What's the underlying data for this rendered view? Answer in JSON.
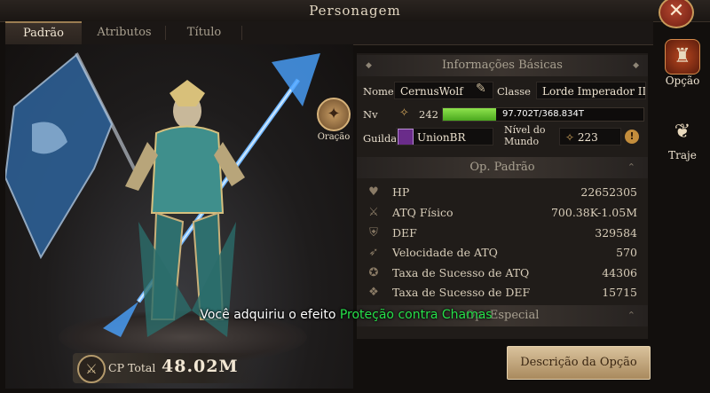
{
  "window": {
    "title": "Personagem",
    "close_glyph": "✕"
  },
  "tabs": [
    {
      "label": "Padrão",
      "active": true
    },
    {
      "label": "Atributos",
      "active": false
    },
    {
      "label": "Título",
      "active": false
    }
  ],
  "scene": {
    "oracao_label": "Oração",
    "oracao_icon": "prayer-icon"
  },
  "basic_info": {
    "header": "Informações Básicas",
    "nome_label": "Nome",
    "nome_value": "CernusWolf",
    "classe_label": "Classe",
    "classe_value": "Lorde Imperador III (INT)",
    "nv_label": "Nv",
    "nv_value": "242",
    "exp_text": "97.702T/368.834T",
    "exp_fraction": 0.265,
    "guilda_label": "Guilda",
    "guilda_value": "UnionBR",
    "nivel_mundo_label_1": "Nível do",
    "nivel_mundo_label_2": "Mundo",
    "nivel_mundo_value": "223",
    "info_glyph": "!"
  },
  "op_padrao": {
    "header": "Op. Padrão",
    "stats": [
      {
        "name": "HP",
        "value": "22652305",
        "icon": "hp-icon"
      },
      {
        "name": "ATQ Físico",
        "value": "700.38K-1.05M",
        "icon": "attack-icon"
      },
      {
        "name": "DEF",
        "value": "329584",
        "icon": "defense-icon"
      },
      {
        "name": "Velocidade de ATQ",
        "value": "570",
        "icon": "attack-speed-icon"
      },
      {
        "name": "Taxa de Sucesso de ATQ",
        "value": "44306",
        "icon": "hit-rate-icon"
      },
      {
        "name": "Taxa de Sucesso de DEF",
        "value": "15715",
        "icon": "evasion-icon"
      }
    ]
  },
  "op_especial": {
    "header": "Op. Especial"
  },
  "side_buttons": [
    {
      "label": "Opção",
      "icon": "helmet-icon"
    },
    {
      "label": "Traje",
      "icon": "costume-icon"
    }
  ],
  "cp": {
    "label": "CP Total",
    "value": "48.02M"
  },
  "description_button": {
    "label": "Descrição da Opção"
  },
  "toast": {
    "prefix": "Você adquiriu o efeito ",
    "highlight": "Proteção contra Chamas"
  },
  "colors": {
    "accent": "#9b7d52",
    "exp_bar": "#5fce2f",
    "toast_highlight": "#27e04a"
  }
}
